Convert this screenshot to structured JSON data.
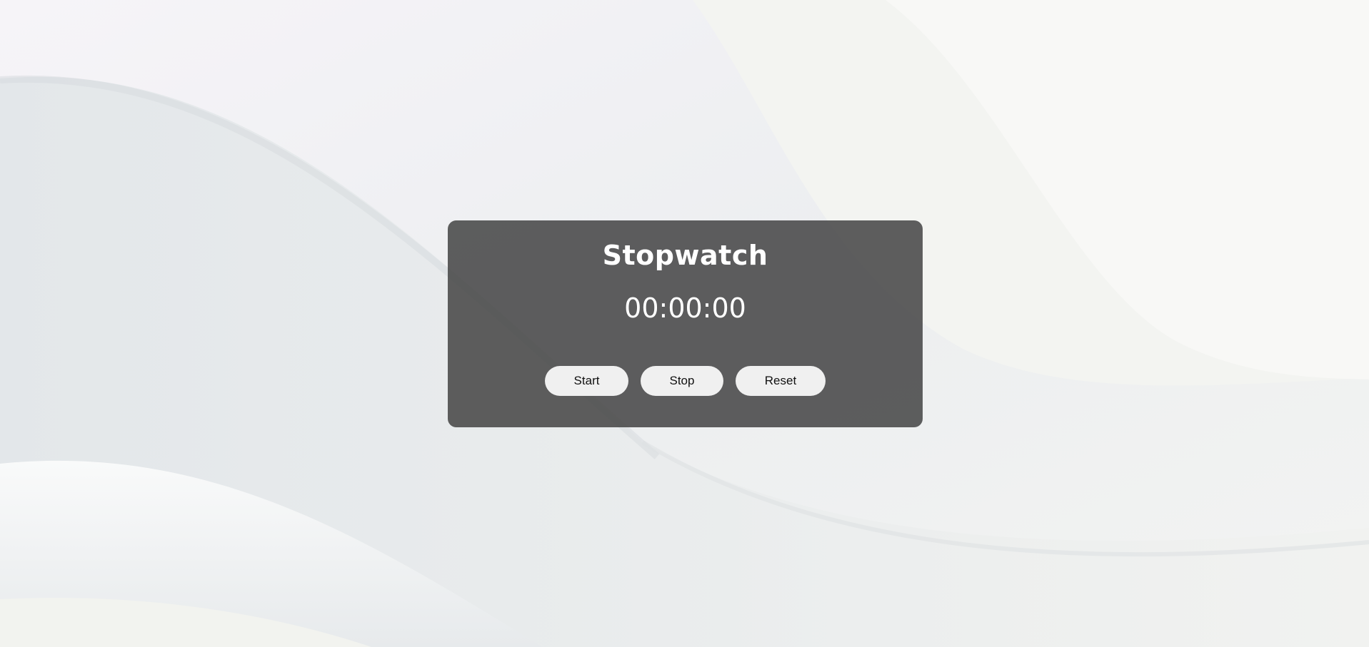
{
  "stopwatch": {
    "title": "Stopwatch",
    "time": "00:00:00",
    "buttons": {
      "start": "Start",
      "stop": "Stop",
      "reset": "Reset"
    }
  },
  "colors": {
    "card_background": "#484848",
    "button_background": "#f0f0f0",
    "text": "#ffffff"
  }
}
